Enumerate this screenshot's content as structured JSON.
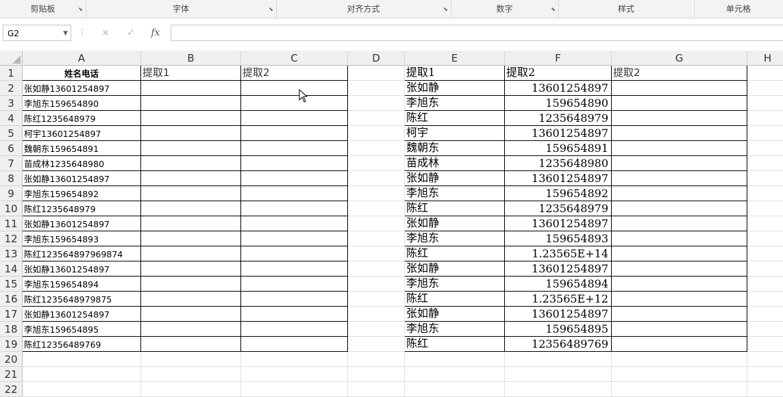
{
  "ribbon": {
    "groups": [
      "剪贴板",
      "字体",
      "对齐方式",
      "数字",
      "样式",
      "单元格"
    ]
  },
  "formula_bar": {
    "name_box": "G2",
    "cancel_icon": "×",
    "enter_icon": "✓",
    "fx_label": "fx",
    "formula": ""
  },
  "columns": [
    "A",
    "B",
    "C",
    "D",
    "E",
    "F",
    "G",
    "H"
  ],
  "rows": [
    "1",
    "2",
    "3",
    "4",
    "5",
    "6",
    "7",
    "8",
    "9",
    "10",
    "11",
    "12",
    "13",
    "14",
    "15",
    "16",
    "17",
    "18",
    "19",
    "20",
    "21",
    "22"
  ],
  "sheet": {
    "A": [
      "姓名电话",
      "张如静13601254897",
      "李旭东159654890",
      "陈红1235648979",
      "柯宇13601254897",
      "魏朝东159654891",
      "苗成林1235648980",
      "张如静13601254897",
      "李旭东159654892",
      "陈红1235648979",
      "张如静13601254897",
      "李旭东159654893",
      "陈红123564897969874",
      "张如静13601254897",
      "李旭东159654894",
      "陈红1235648979875",
      "张如静13601254897",
      "李旭东159654895",
      "陈红12356489769"
    ],
    "B1": "提取1",
    "C1": "提取2",
    "E": [
      "提取1",
      "张如静",
      "李旭东",
      "陈红",
      "柯宇",
      "魏朝东",
      "苗成林",
      "张如静",
      "李旭东",
      "陈红",
      "张如静",
      "李旭东",
      "陈红",
      "张如静",
      "李旭东",
      "陈红",
      "张如静",
      "李旭东",
      "陈红"
    ],
    "F": [
      "提取2",
      "13601254897",
      "159654890",
      "1235648979",
      "13601254897",
      "159654891",
      "1235648980",
      "13601254897",
      "159654892",
      "1235648979",
      "13601254897",
      "159654893",
      "1.23565E+14",
      "13601254897",
      "159654894",
      "1.23565E+12",
      "13601254897",
      "159654895",
      "12356489769"
    ],
    "G1": "提取2"
  }
}
